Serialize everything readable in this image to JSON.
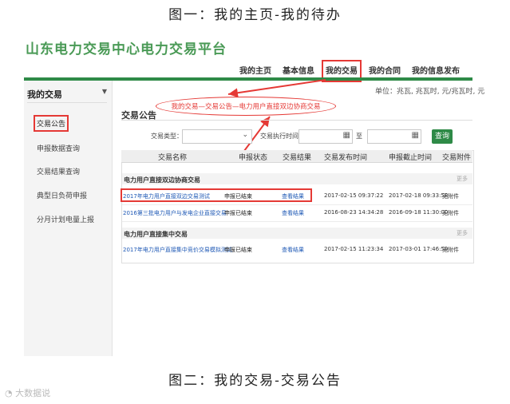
{
  "captions": {
    "top": "图一：我的主页-我的待办",
    "bottom": "图二：我的交易-交易公告"
  },
  "brand": "山东电力交易中心电力交易平台",
  "topnav": [
    {
      "label": "我的主页",
      "active": false
    },
    {
      "label": "基本信息",
      "active": false
    },
    {
      "label": "我的交易",
      "active": true
    },
    {
      "label": "我的合同",
      "active": false
    },
    {
      "label": "我的信息发布",
      "active": false
    }
  ],
  "unit_text": "单位：兆瓦, 兆瓦时, 元/兆瓦时, 元",
  "sidebar": {
    "title": "我的交易",
    "items": [
      {
        "label": "交易公告",
        "active": true
      },
      {
        "label": "申报数据查询",
        "active": false
      },
      {
        "label": "交易结果查询",
        "active": false
      },
      {
        "label": "典型日负荷申报",
        "active": false
      },
      {
        "label": "分月计划电量上报",
        "active": false
      }
    ]
  },
  "annotation": "我的交易—交易公告—电力用户直接双边协商交易",
  "section_title": "交易公告",
  "filters": {
    "type_label": "交易类型：",
    "time_label": "交易执行时间：",
    "to_label": "至",
    "query_button": "查询"
  },
  "table": {
    "headers": [
      "交易名称",
      "申报状态",
      "交易结果",
      "交易发布时间",
      "申报截止时间",
      "交易附件"
    ],
    "more_label": "更多",
    "groups": [
      {
        "title": "电力用户直接双边协商交易",
        "rows": [
          {
            "name": "2017年电力用户直接双边交易测试",
            "status": "申报已结束",
            "result": "查看结果",
            "published": "2017-02-15 09:37:22",
            "deadline": "2017-02-18 09:33:58",
            "attachment": "无附件"
          },
          {
            "name": "2016第三批电力用户与发电企业直接交易",
            "status": "申报已结束",
            "result": "查看结果",
            "published": "2016-08-23 14:34:28",
            "deadline": "2016-09-18 11:30:00",
            "attachment": "无附件"
          }
        ]
      },
      {
        "title": "电力用户直接集中交易",
        "rows": [
          {
            "name": "2017年电力用户直接集中竞价交易模拟测试",
            "status": "申报已结束",
            "result": "查看结果",
            "published": "2017-02-15 11:23:34",
            "deadline": "2017-03-01 17:46:59",
            "attachment": "无附件"
          }
        ]
      }
    ]
  },
  "watermark": "大数据说",
  "colors": {
    "brand_green": "#4a9a56",
    "nav_bar_green": "#2e8a47",
    "highlight_red": "#e53935",
    "link_blue": "#1e58b5"
  }
}
